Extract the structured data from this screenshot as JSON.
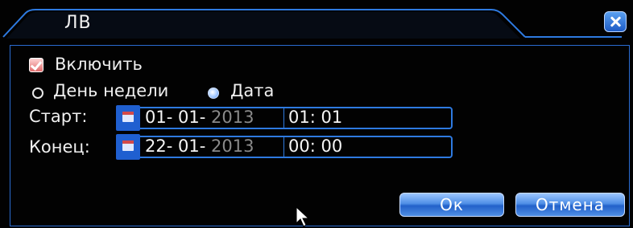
{
  "window": {
    "title": "ЛВ"
  },
  "enable": {
    "label": "Включить",
    "checked": true
  },
  "mode": {
    "options": [
      "День недели",
      "Дата"
    ],
    "selected": "Дата"
  },
  "start": {
    "label": "Старт:",
    "date_day": "01",
    "date_month": "01",
    "date_year": "2013",
    "time": "01: 01"
  },
  "end": {
    "label": "Конец:",
    "date_day": "22",
    "date_month": "01",
    "date_year": "2013",
    "time": "00: 00"
  },
  "buttons": {
    "ok": "Ок",
    "cancel": "Отмена"
  },
  "colors": {
    "accent": "#2e7ae0",
    "background": "#000000"
  },
  "icons": {
    "close": "close-icon",
    "calendar": "calendar-icon",
    "cursor": "mouse-cursor-icon"
  }
}
